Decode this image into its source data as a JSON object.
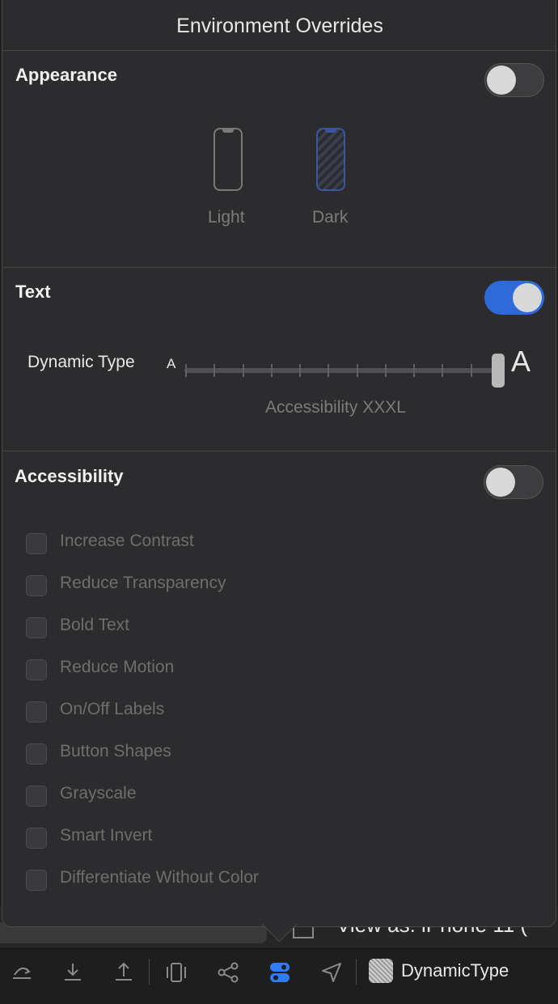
{
  "popover": {
    "title": "Environment Overrides"
  },
  "appearance": {
    "heading": "Appearance",
    "toggle_on": false,
    "options": [
      {
        "label": "Light"
      },
      {
        "label": "Dark"
      }
    ]
  },
  "text": {
    "heading": "Text",
    "toggle_on": true,
    "dynamic_type_label": "Dynamic Type",
    "small_glyph": "A",
    "large_glyph": "A",
    "selected_size": "Accessibility XXXL",
    "slider_steps": 12,
    "slider_level": 11
  },
  "accessibility": {
    "heading": "Accessibility",
    "toggle_on": false,
    "options": [
      {
        "label": "Increase Contrast",
        "checked": false
      },
      {
        "label": "Reduce Transparency",
        "checked": false
      },
      {
        "label": "Bold Text",
        "checked": false
      },
      {
        "label": "Reduce Motion",
        "checked": false
      },
      {
        "label": "On/Off Labels",
        "checked": false
      },
      {
        "label": "Button Shapes",
        "checked": false
      },
      {
        "label": "Grayscale",
        "checked": false
      },
      {
        "label": "Smart Invert",
        "checked": false
      },
      {
        "label": "Differentiate Without Color",
        "checked": false
      }
    ]
  },
  "background": {
    "text": "View as: iPhone 11 ("
  },
  "toolbar": {
    "icons": [
      "breakpoint-step-over-icon",
      "step-into-icon",
      "step-out-icon",
      "debug-view-hierarchy-icon",
      "memory-graph-icon",
      "environment-overrides-icon",
      "simulate-location-icon"
    ],
    "scheme_name": "DynamicType"
  },
  "colors": {
    "accent": "#2f6bd8",
    "popover_bg": "#2c2c2e"
  }
}
